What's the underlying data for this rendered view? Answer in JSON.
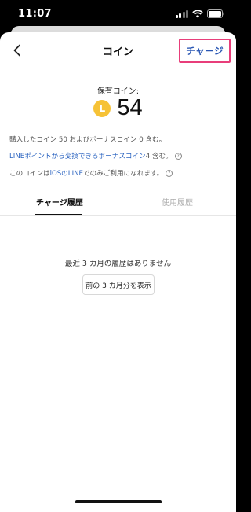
{
  "status_bar": {
    "time": "11:07"
  },
  "nav": {
    "title": "コイン",
    "charge_label": "チャージ"
  },
  "balance": {
    "label": "保有コイン:",
    "icon_letter": "L",
    "count": "54"
  },
  "info": {
    "line1": "購入したコイン 50 およびボーナスコイン 0 含む。",
    "line2_link": "LINEポイントから変換できるボーナスコイン",
    "line2_rest": " 4 含む。",
    "line3_pre": "このコインは",
    "line3_link": "iOSのLINE",
    "line3_post": "でのみご利用になれます。",
    "help_glyph": "?"
  },
  "tabs": {
    "charge_history": "チャージ履歴",
    "usage_history": "使用履歴"
  },
  "empty": {
    "message": "最近 3 カ月の履歴はありません",
    "prev_button": "前の 3 カ月分を表示"
  },
  "colors": {
    "accent_link": "#2a63c0",
    "highlight_border": "#e83e7a",
    "coin": "#f6c236"
  }
}
